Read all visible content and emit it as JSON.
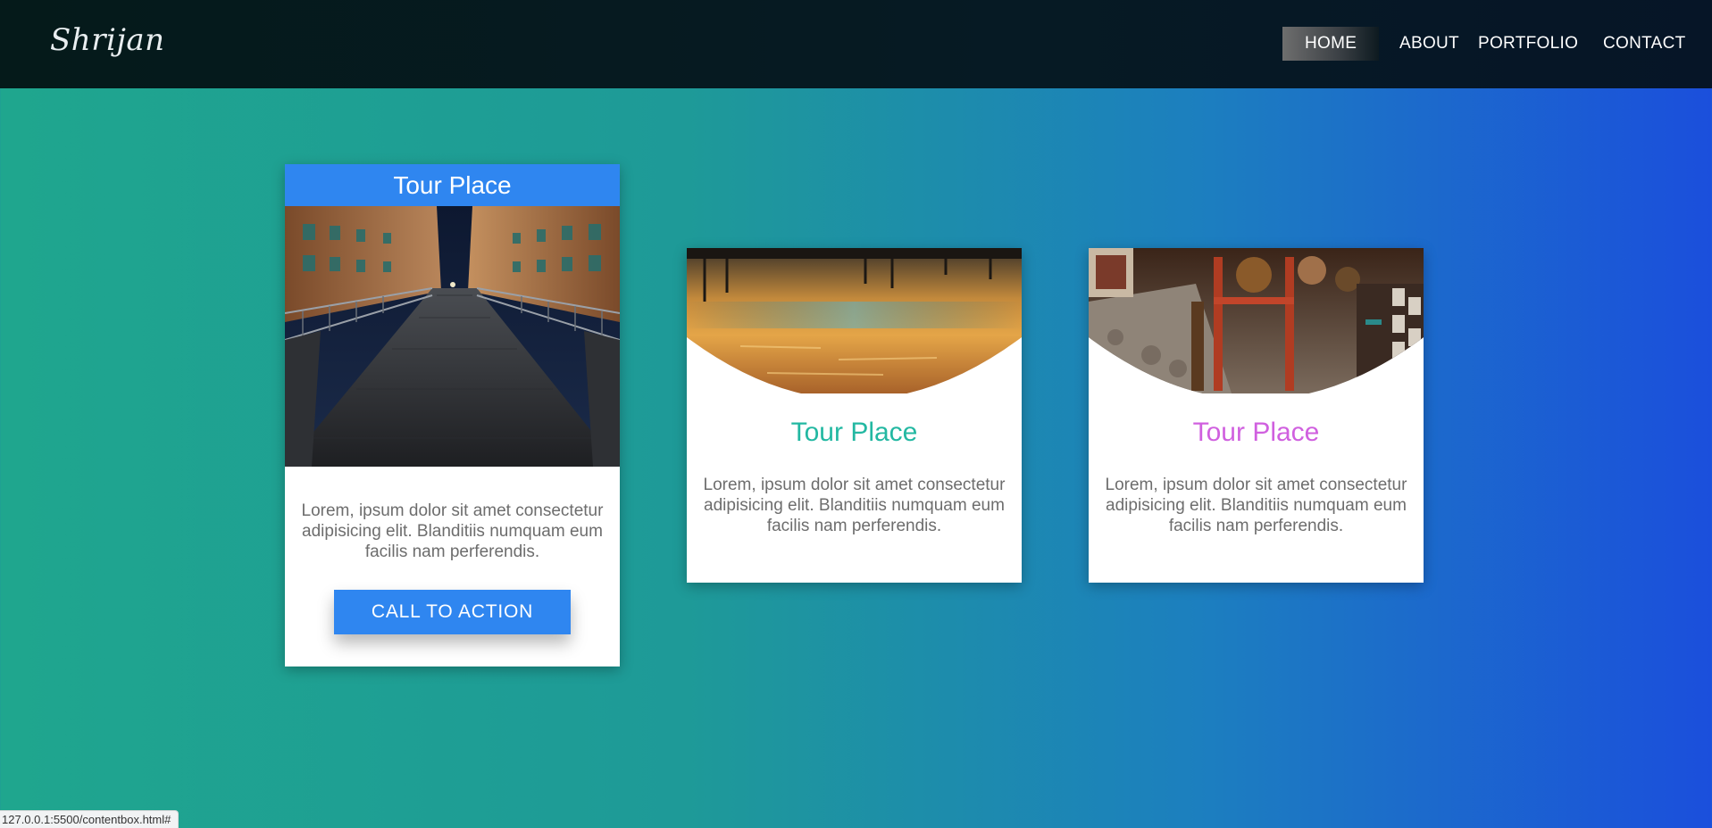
{
  "header": {
    "logo_text": "Shrijan",
    "nav": [
      {
        "label": "HOME",
        "active": true
      },
      {
        "label": "ABOUT",
        "active": false
      },
      {
        "label": "PORTFOLIO",
        "active": false
      },
      {
        "label": "CONTACT",
        "active": false
      }
    ]
  },
  "cards": [
    {
      "title": "Tour Place",
      "image": "bridge-night-photo",
      "text": "Lorem, ipsum dolor sit amet consectetur adipisicing elit. Blanditiis numquam eum facilis nam perferendis.",
      "button": "CALL TO ACTION",
      "accent": "#2f86f0"
    },
    {
      "title": "Tour Place",
      "image": "water-reflection-photo",
      "text": "Lorem, ipsum dolor sit amet consectetur adipisicing elit. Blanditiis numquam eum facilis nam perferendis.",
      "accent": "#23b8a2"
    },
    {
      "title": "Tour Place",
      "image": "market-stall-photo",
      "text": "Lorem, ipsum dolor sit amet consectetur adipisicing elit. Blanditiis numquam eum facilis nam perferendis.",
      "accent": "#d060df"
    }
  ],
  "status_bar": {
    "url": "127.0.0.1:5500/contentbox.html#"
  },
  "colors": {
    "background_start": "#1fa68e",
    "background_end": "#1b4fdc",
    "header_bg": "#051a1a"
  }
}
